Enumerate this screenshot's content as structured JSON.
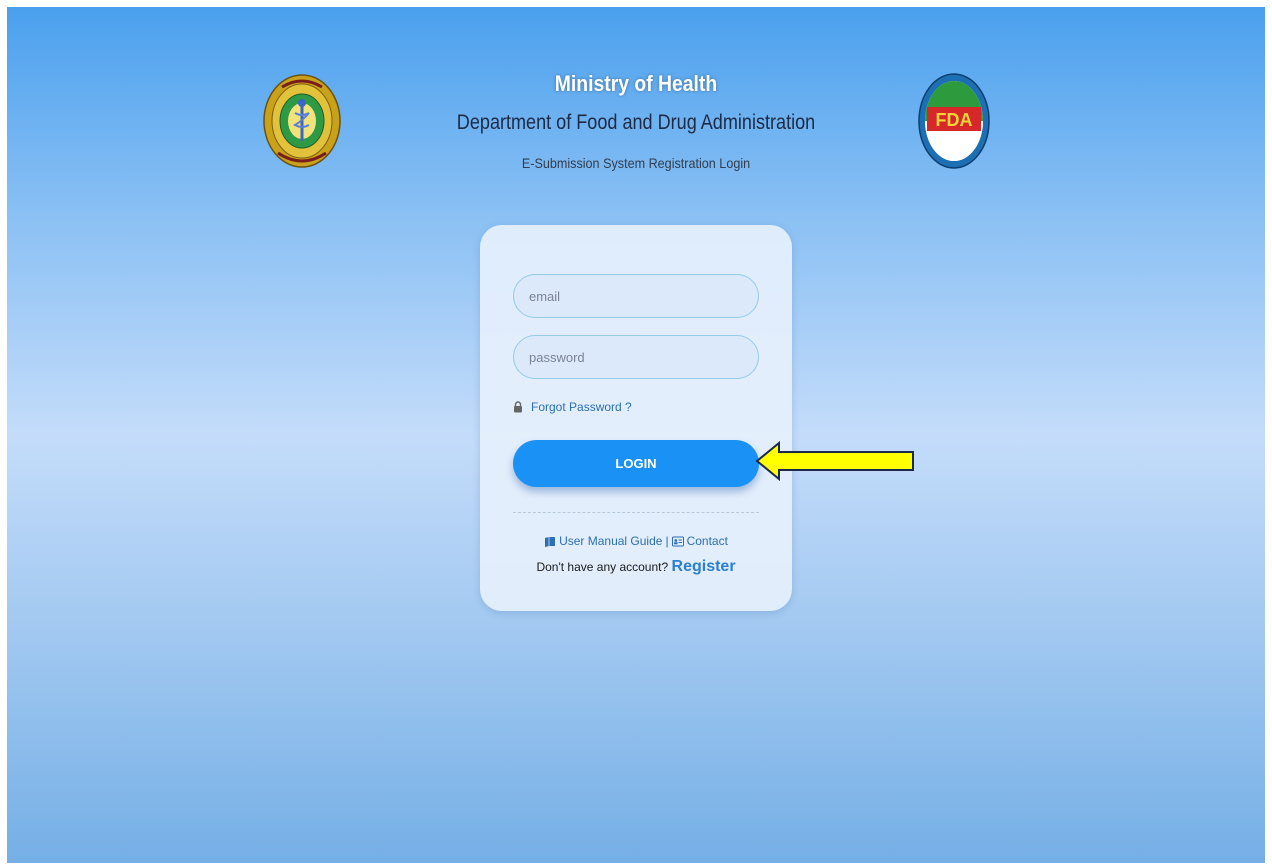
{
  "header": {
    "title": "Ministry of Health",
    "subtitle": "Department of Food and Drug Administration",
    "system_name": "E-Submission System Registration Login",
    "left_logo": "ministry-of-health-emblem",
    "left_logo_text": "MINISTRY OF HEALTH",
    "right_logo": "fda-logo",
    "right_logo_text": "FDA"
  },
  "login_form": {
    "email_placeholder": "email",
    "password_placeholder": "password",
    "email_value": "",
    "password_value": "",
    "forgot_password_label": "Forgot Password ?",
    "login_button_label": "LOGIN",
    "user_manual_label": "User Manual Guide",
    "separator": "|",
    "contact_label": "Contact",
    "no_account_text": "Don't have any account?",
    "register_label": "Register"
  },
  "annotation": {
    "arrow_color": "#ffff00",
    "arrow_target": "login-button"
  },
  "colors": {
    "accent": "#1a91f5",
    "link": "#2b6fb4",
    "background_top": "#4aa0ee",
    "background_mid": "#c4dcfa"
  }
}
